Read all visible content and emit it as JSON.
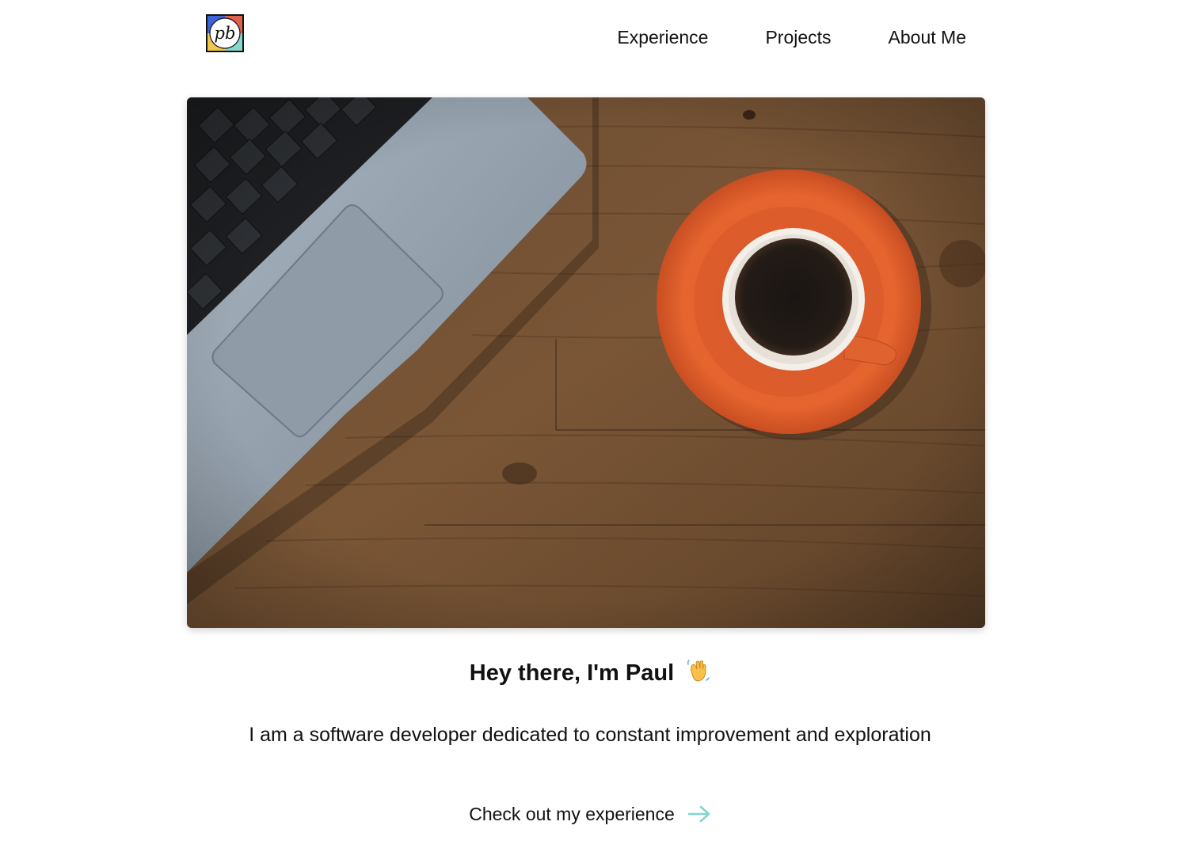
{
  "header": {
    "logo_text": "pb",
    "nav": [
      {
        "label": "Experience"
      },
      {
        "label": "Projects"
      },
      {
        "label": "About Me"
      }
    ]
  },
  "hero": {
    "image": "laptop-and-coffee-on-wooden-desk"
  },
  "intro": {
    "greeting": "Hey there, I'm Paul",
    "greeting_icon": "waving-hand-icon",
    "tagline": "I am a software developer dedicated to constant improvement and exploration"
  },
  "cta": {
    "label": "Check out my experience",
    "icon": "arrow-right-icon",
    "icon_color": "#7fd6cf"
  }
}
